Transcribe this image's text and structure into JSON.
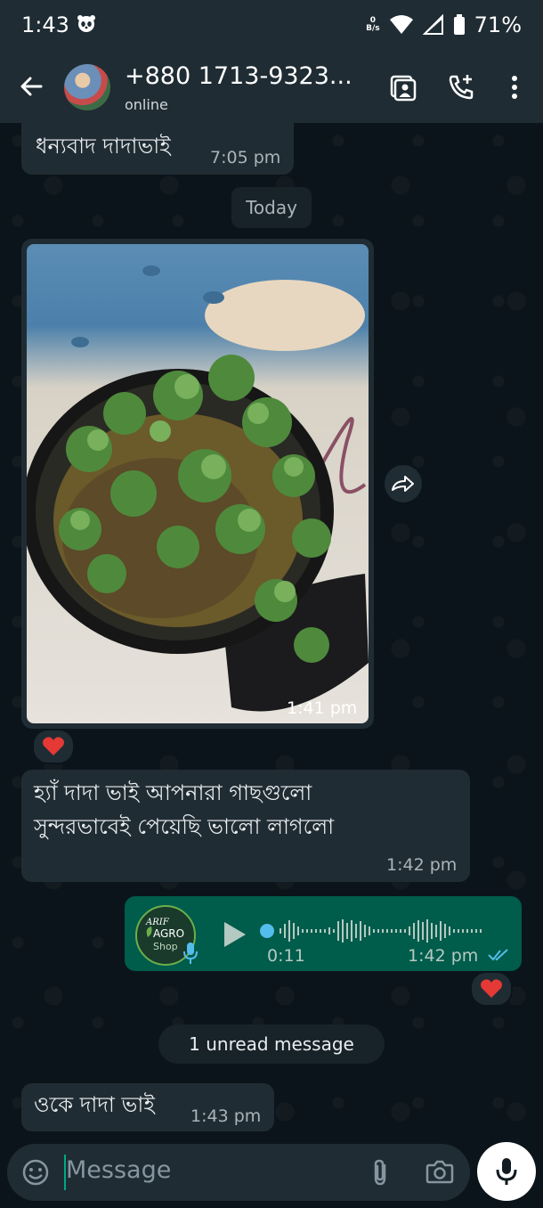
{
  "status_bar": {
    "time": "1:43",
    "net_speed_value": "0",
    "net_speed_unit": "B/s",
    "battery": "71%"
  },
  "header": {
    "contact_name": "+880 1713-9323...",
    "contact_status": "online"
  },
  "messages": [
    {
      "direction": "in",
      "text": "ধন্যবাদ দাদাভাই",
      "time": "7:05 pm"
    },
    {
      "date_chip": "Today"
    },
    {
      "direction": "in",
      "type": "image",
      "time": "1:41 pm",
      "reaction": "heart"
    },
    {
      "direction": "in",
      "text_line1": "হ্যাঁ দাদা ভাই আপনারা গাছগুলো",
      "text_line2": "সুন্দরভাবেই পেয়েছি ভালো লাগলো",
      "time": "1:42 pm"
    },
    {
      "direction": "out",
      "type": "voice",
      "duration": "0:11",
      "time": "1:42 pm",
      "status": "read",
      "reaction": "heart",
      "avatar_logo": "ARIF AGRO SHOP"
    },
    {
      "unread_chip": "1 unread message"
    },
    {
      "direction": "in",
      "text": "ওকে দাদা ভাই",
      "time": "1:43 pm"
    }
  ],
  "composer": {
    "placeholder": "Message"
  },
  "colors": {
    "background": "#0b141a",
    "bubble_incoming": "#202c33",
    "bubble_outgoing": "#005c4b",
    "accent": "#00a884",
    "read_ticks": "#53bdeb",
    "heart": "#e53935"
  }
}
